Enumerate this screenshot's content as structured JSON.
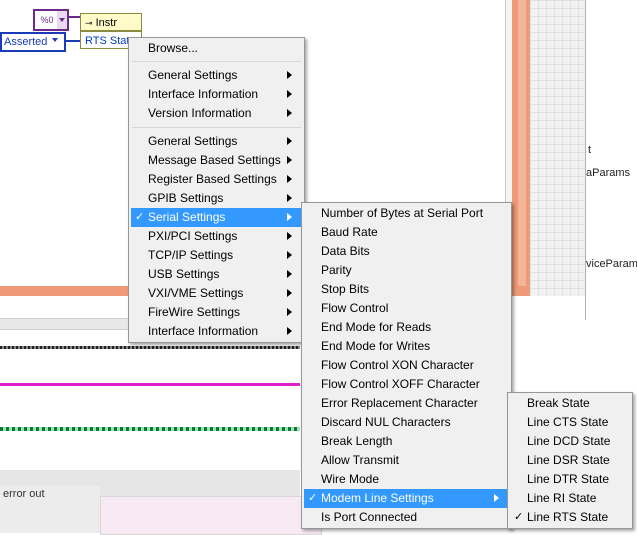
{
  "diagram": {
    "constant_label": "%0",
    "instr_node_label": "Instr",
    "property_label": "RTS State",
    "enum_value": "Asserted",
    "error_out_label": "error out",
    "right_labels": [
      "t",
      "aParams",
      "viceParam"
    ]
  },
  "menu_main": {
    "items": [
      {
        "label": "Browse...",
        "submenu": false
      },
      {
        "label": "General Settings",
        "submenu": true
      },
      {
        "label": "Interface Information",
        "submenu": true
      },
      {
        "label": "Version Information",
        "submenu": true
      },
      {
        "label": "General Settings",
        "submenu": true
      },
      {
        "label": "Message Based Settings",
        "submenu": true
      },
      {
        "label": "Register Based Settings",
        "submenu": true
      },
      {
        "label": "GPIB Settings",
        "submenu": true
      },
      {
        "label": "Serial Settings",
        "submenu": true,
        "selected": true
      },
      {
        "label": "PXI/PCI Settings",
        "submenu": true
      },
      {
        "label": "TCP/IP Settings",
        "submenu": true
      },
      {
        "label": "USB Settings",
        "submenu": true
      },
      {
        "label": "VXI/VME Settings",
        "submenu": true
      },
      {
        "label": "FireWire Settings",
        "submenu": true
      },
      {
        "label": "Interface Information",
        "submenu": true
      }
    ]
  },
  "menu_serial": {
    "items": [
      {
        "label": "Number of Bytes at Serial Port"
      },
      {
        "label": "Baud Rate"
      },
      {
        "label": "Data Bits"
      },
      {
        "label": "Parity"
      },
      {
        "label": "Stop Bits"
      },
      {
        "label": "Flow Control"
      },
      {
        "label": "End Mode for Reads"
      },
      {
        "label": "End Mode for Writes"
      },
      {
        "label": "Flow Control XON Character"
      },
      {
        "label": "Flow Control XOFF Character"
      },
      {
        "label": "Error Replacement Character"
      },
      {
        "label": "Discard NUL Characters"
      },
      {
        "label": "Break Length"
      },
      {
        "label": "Allow Transmit"
      },
      {
        "label": "Wire Mode"
      },
      {
        "label": "Modem Line Settings",
        "submenu": true,
        "selected": true
      },
      {
        "label": "Is Port Connected"
      }
    ]
  },
  "menu_modem": {
    "items": [
      {
        "label": "Break State"
      },
      {
        "label": "Line CTS State"
      },
      {
        "label": "Line DCD State"
      },
      {
        "label": "Line DSR State"
      },
      {
        "label": "Line DTR State"
      },
      {
        "label": "Line RI State"
      },
      {
        "label": "Line RTS State",
        "checked": true
      }
    ]
  },
  "check_glyph": "✓",
  "colors": {
    "highlight": "#3399ff",
    "menu_bg": "#f0f0f0",
    "frame_orange": "#ee9977"
  }
}
